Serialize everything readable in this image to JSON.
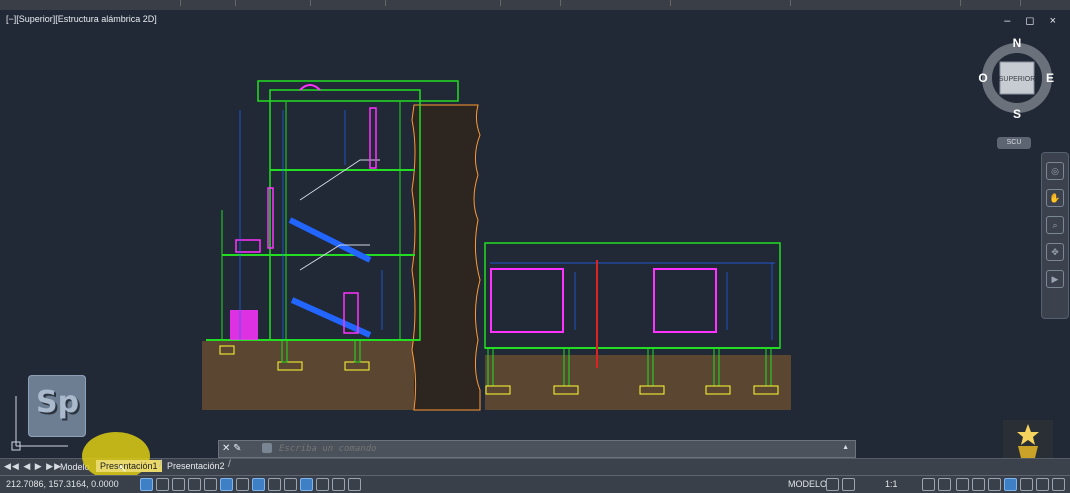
{
  "viewport": {
    "label": "[−][Superior][Estructura alámbrica 2D]",
    "window_controls": "– ◻ ×"
  },
  "viewcube": {
    "north": "N",
    "south": "S",
    "east": "E",
    "west": "O",
    "face": "SUPERIOR",
    "ucs_button": "SCU"
  },
  "logo": {
    "text": "Sp"
  },
  "command_line": {
    "placeholder": "Escriba un comando",
    "icons": "✕ ✎"
  },
  "tabs": {
    "nav": "◀◀ ◀ ▶ ▶▶",
    "items": [
      {
        "label": "Modelo"
      },
      {
        "label": "Presentación1"
      },
      {
        "label": "Presentación2"
      }
    ]
  },
  "status": {
    "coords": "212.7086, 157.3164, 0.0000",
    "mode": "MODELO",
    "scale": "1:1"
  },
  "colors": {
    "background": "#212836",
    "green": "#22dd22",
    "magenta": "#ff33ff",
    "blue": "#2266ff",
    "ground": "#5b4632",
    "outline": "#ff9933"
  }
}
